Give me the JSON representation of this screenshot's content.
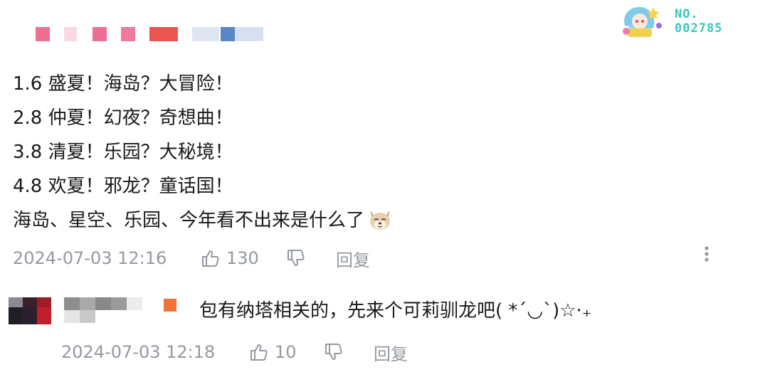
{
  "badge": {
    "no_label": "NO.",
    "no_number": "002785"
  },
  "comment": {
    "lines": [
      "1.6 盛夏！海岛？大冒险！",
      "2.8 仲夏！幻夜？奇想曲！",
      "3.8 清夏！乐园？大秘境！",
      "4.8 欢夏！邪龙？童话国！",
      "海岛、星空、乐园、今年看不出来是什么了"
    ],
    "timestamp": "2024-07-03 12:16",
    "like_count": "130",
    "reply_label": "回复",
    "more_icon": "vertical-dots-icon",
    "emoji": "dog-emoji"
  },
  "reply": {
    "text": "包有纳塔相关的，先来个可莉驯龙吧( *´◡`)☆·₊",
    "timestamp": "2024-07-03 12:18",
    "like_count": "10",
    "reply_label": "回复",
    "level_badge_color": "#f0743a"
  },
  "colors": {
    "text_primary": "#18191c",
    "text_secondary": "#9499a0",
    "accent_teal": "#39c5bb"
  }
}
